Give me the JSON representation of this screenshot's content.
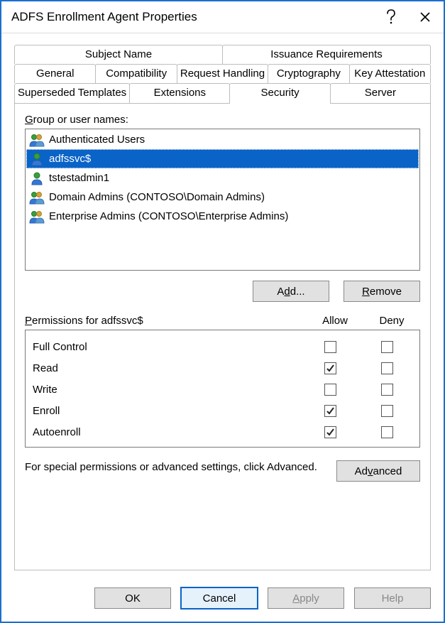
{
  "title": "ADFS Enrollment Agent Properties",
  "tabs": {
    "row_top": [
      "Subject Name",
      "Issuance Requirements"
    ],
    "row_mid": [
      "General",
      "Compatibility",
      "Request Handling",
      "Cryptography",
      "Key Attestation"
    ],
    "row_bot": [
      "Superseded Templates",
      "Extensions",
      "Security",
      "Server"
    ],
    "active": "Security"
  },
  "group_label_pre": "",
  "group_label_key": "G",
  "group_label_post": "roup or user names:",
  "principals": [
    {
      "name": "Authenticated Users",
      "icon": "group",
      "selected": false
    },
    {
      "name": "adfssvc$",
      "icon": "user",
      "selected": true
    },
    {
      "name": "tstestadmin1",
      "icon": "user",
      "selected": false
    },
    {
      "name": "Domain Admins (CONTOSO\\Domain Admins)",
      "icon": "group",
      "selected": false
    },
    {
      "name": "Enterprise Admins (CONTOSO\\Enterprise Admins)",
      "icon": "group",
      "selected": false
    }
  ],
  "buttons": {
    "add_pre": "A",
    "add_key": "d",
    "add_post": "d...",
    "remove_key": "R",
    "remove_post": "emove",
    "advanced_pre": "Ad",
    "advanced_key": "v",
    "advanced_post": "anced",
    "ok": "OK",
    "cancel": "Cancel",
    "apply_key": "A",
    "apply_post": "pply",
    "help": "Help"
  },
  "perm_header_pre": "",
  "perm_header_key": "P",
  "perm_header_post": "ermissions for adfssvc$",
  "perm_cols": {
    "allow": "Allow",
    "deny": "Deny"
  },
  "permissions": [
    {
      "name": "Full Control",
      "allow": false,
      "deny": false
    },
    {
      "name": "Read",
      "allow": true,
      "deny": false
    },
    {
      "name": "Write",
      "allow": false,
      "deny": false
    },
    {
      "name": "Enroll",
      "allow": true,
      "deny": false
    },
    {
      "name": "Autoenroll",
      "allow": true,
      "deny": false
    }
  ],
  "advanced_text": "For special permissions or advanced settings, click Advanced."
}
